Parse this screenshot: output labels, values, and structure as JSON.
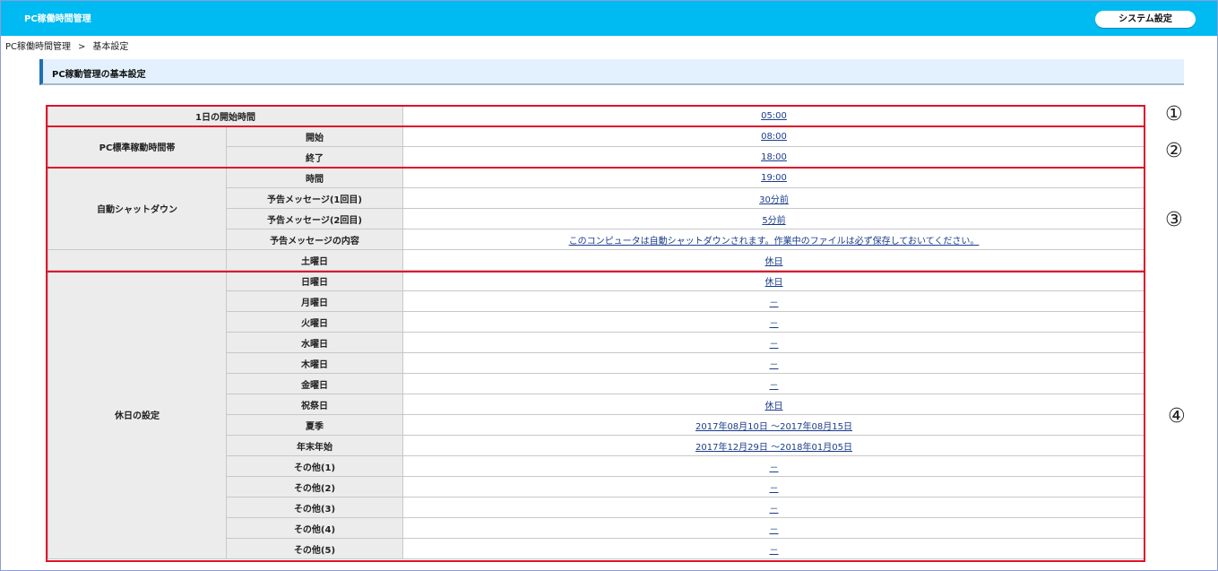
{
  "header": {
    "app_title": "PC稼働時間管理",
    "system_settings_label": "システム設定"
  },
  "breadcrumb": {
    "root": "PC稼働時間管理",
    "separator": ">",
    "current": "基本設定"
  },
  "section": {
    "title": "PC稼動管理の基本設定"
  },
  "settings": {
    "start_time": {
      "label": "1日の開始時間",
      "value": "05:00"
    },
    "standard_hours": {
      "group": "PC標準稼動時間帯",
      "start": {
        "label": "開始",
        "value": "08:00"
      },
      "end": {
        "label": "終了",
        "value": "18:00"
      }
    },
    "auto_shutdown": {
      "group": "自動シャットダウン",
      "time": {
        "label": "時間",
        "value": "19:00"
      },
      "notice1": {
        "label": "予告メッセージ(1回目)",
        "value": "30分前"
      },
      "notice2": {
        "label": "予告メッセージ(2回目)",
        "value": "5分前"
      },
      "notice_text": {
        "label": "予告メッセージの内容",
        "value": "このコンピュータは自動シャットダウンされます。作業中のファイルは必ず保存しておいてください。"
      }
    },
    "holidays": {
      "group": "休日の設定",
      "saturday": {
        "label": "土曜日",
        "value": "休日"
      },
      "sunday": {
        "label": "日曜日",
        "value": "休日"
      },
      "monday": {
        "label": "月曜日",
        "value": "－"
      },
      "tuesday": {
        "label": "火曜日",
        "value": "－"
      },
      "wednesday": {
        "label": "水曜日",
        "value": "－"
      },
      "thursday": {
        "label": "木曜日",
        "value": "－"
      },
      "friday": {
        "label": "金曜日",
        "value": "－"
      },
      "national": {
        "label": "祝祭日",
        "value": "休日"
      },
      "summer": {
        "label": "夏季",
        "value": "2017年08月10日 ～2017年08月15日"
      },
      "year_end": {
        "label": "年末年始",
        "value": "2017年12月29日 ～2018年01月05日"
      },
      "other1": {
        "label": "その他(1)",
        "value": "－"
      },
      "other2": {
        "label": "その他(2)",
        "value": "－"
      },
      "other3": {
        "label": "その他(3)",
        "value": "－"
      },
      "other4": {
        "label": "その他(4)",
        "value": "－"
      },
      "other5": {
        "label": "その他(5)",
        "value": "－"
      }
    }
  },
  "annotations": {
    "n1": "①",
    "n2": "②",
    "n3": "③",
    "n4": "④"
  },
  "colors": {
    "header_bg": "#00bbf2",
    "highlight": "#e0102a",
    "section_bg": "#e2f1fd"
  }
}
